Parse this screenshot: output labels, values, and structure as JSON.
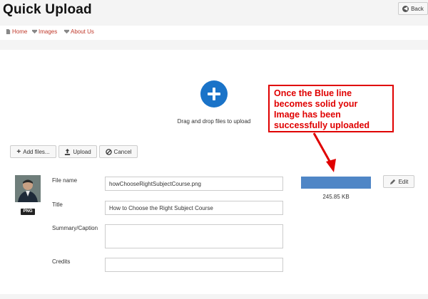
{
  "page": {
    "title": "Quick Upload"
  },
  "header": {
    "back_label": "Back"
  },
  "nav": {
    "items": [
      {
        "label": "Home",
        "icon": "page-icon"
      },
      {
        "label": "Images",
        "icon": "images-icon"
      },
      {
        "label": "About Us",
        "icon": "about-icon"
      }
    ]
  },
  "dropzone": {
    "text": "Drag and drop files to upload",
    "icon": "plus-circle-icon",
    "accent": "#1a73c8"
  },
  "toolbar": {
    "add_label": "Add files...",
    "upload_label": "Upload",
    "cancel_label": "Cancel"
  },
  "callout": {
    "lines": [
      "Once the Blue line",
      "becomes solid your",
      "Image has been",
      "successfully uploaded"
    ],
    "color": "#e00000"
  },
  "file": {
    "type_badge": "PNG",
    "progress": 1.0,
    "progress_color": "#4f86c6",
    "size": "245.85 KB",
    "edit_label": "Edit",
    "fields": {
      "file_name_label": "File name",
      "file_name_value": "howChooseRightSubjectCourse.png",
      "title_label": "Title",
      "title_value": "How to Choose the Right Subject Course",
      "summary_label": "Summary/Caption",
      "summary_value": "",
      "credits_label": "Credits",
      "credits_value": ""
    }
  }
}
